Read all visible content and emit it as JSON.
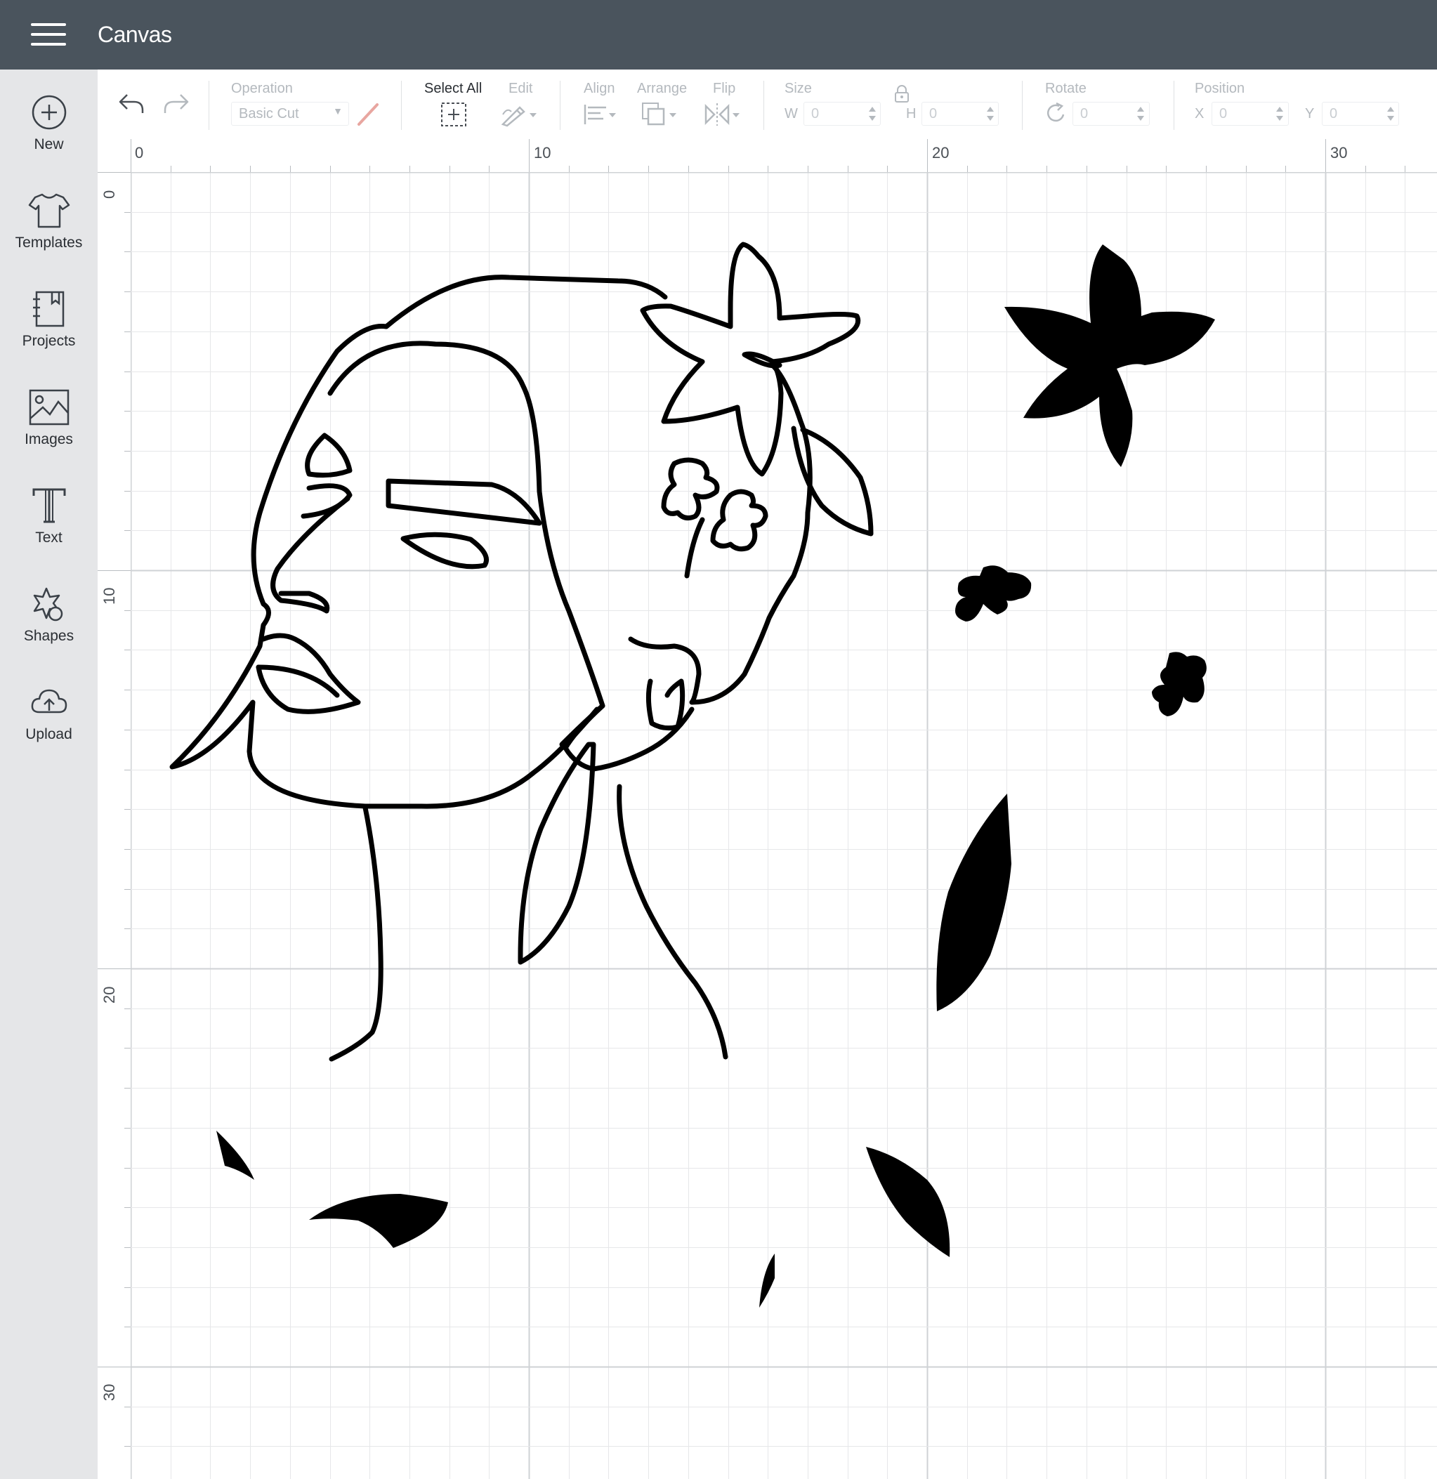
{
  "app": {
    "title": "Canvas"
  },
  "sidebar": {
    "items": [
      {
        "label": "New",
        "icon": "plus-circle-icon"
      },
      {
        "label": "Templates",
        "icon": "tshirt-icon"
      },
      {
        "label": "Projects",
        "icon": "notebook-icon"
      },
      {
        "label": "Images",
        "icon": "image-icon"
      },
      {
        "label": "Text",
        "icon": "text-icon"
      },
      {
        "label": "Shapes",
        "icon": "shapes-icon"
      },
      {
        "label": "Upload",
        "icon": "cloud-upload-icon"
      }
    ]
  },
  "toolbar": {
    "operation_label": "Operation",
    "operation_value": "Basic Cut",
    "select_all_label": "Select All",
    "edit_label": "Edit",
    "align_label": "Align",
    "arrange_label": "Arrange",
    "flip_label": "Flip",
    "size_label": "Size",
    "size_w_letter": "W",
    "size_w_value": "0",
    "size_h_letter": "H",
    "size_h_value": "0",
    "rotate_label": "Rotate",
    "rotate_value": "0",
    "position_label": "Position",
    "position_x_letter": "X",
    "position_x_value": "0",
    "position_y_letter": "Y",
    "position_y_value": "0"
  },
  "rulers": {
    "top": [
      "0",
      "10",
      "20",
      "30"
    ],
    "left": [
      "0",
      "10",
      "20",
      "30"
    ]
  },
  "colors": {
    "topbar": "#4a545d",
    "sidebar": "#e5e6e8",
    "grid_minor": "#e6e7e9",
    "grid_major": "#cfd2d5"
  }
}
